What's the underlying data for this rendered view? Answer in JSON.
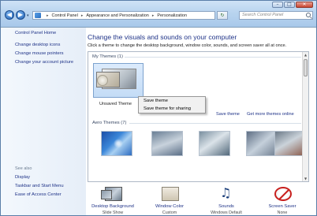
{
  "titlebar": {
    "buttons": {
      "minimize": "–",
      "maximize": "□",
      "close": "✕"
    },
    "nav": {
      "back": "◀",
      "forward": "▶",
      "dropdown": "▾"
    },
    "breadcrumb": [
      "Control Panel",
      "Appearance and Personalization",
      "Personalization"
    ],
    "breadcrumb_sep": "▸",
    "refresh": "↻",
    "search_placeholder": "Search Control Panel"
  },
  "leftnav": {
    "home": "Control Panel Home",
    "links": [
      "Change desktop icons",
      "Change mouse pointers",
      "Change your account picture"
    ],
    "see_also_label": "See also",
    "see_also": [
      "Display",
      "Taskbar and Start Menu",
      "Ease of Access Center"
    ]
  },
  "main": {
    "title": "Change the visuals and sounds on your computer",
    "subtitle": "Click a theme to change the desktop background, window color, sounds, and screen saver all at once.",
    "my_themes_label": "My Themes (1)",
    "unsaved_theme_label": "Unsaved Theme",
    "save_theme_link": "Save theme",
    "get_more_link": "Get more themes online",
    "aero_themes_label": "Aero Themes (7)",
    "scroll": {
      "up": "▲",
      "down": "▼"
    }
  },
  "context_menu": {
    "items": [
      "Save theme",
      "Save theme for sharing"
    ]
  },
  "bottom": {
    "items": [
      {
        "label": "Desktop Background",
        "sub": "Slide Show",
        "icon": "desktop-background-icon"
      },
      {
        "label": "Window Color",
        "sub": "Custom",
        "icon": "window-color-icon"
      },
      {
        "label": "Sounds",
        "sub": "Windows Default",
        "icon": "sounds-icon"
      },
      {
        "label": "Screen Saver",
        "sub": "None",
        "icon": "screen-saver-icon"
      }
    ]
  },
  "colors": {
    "link": "#1e3287",
    "titlebar": "#b9d4ef",
    "leftnav": "#e6eef8",
    "selection": "#c4dcf6"
  }
}
